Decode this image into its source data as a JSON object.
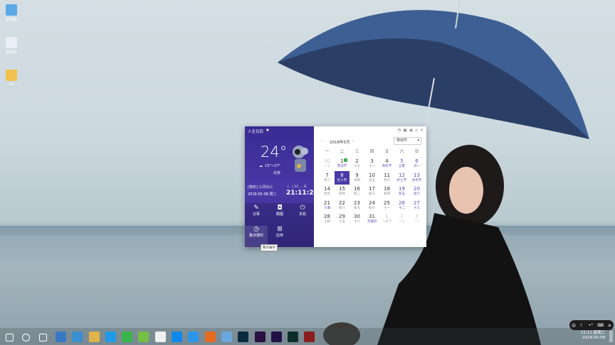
{
  "desktop": {
    "icons": [
      {
        "label": "此电脑",
        "icon": "computer-icon",
        "color": "#5aa9e6"
      },
      {
        "label": "回收站",
        "icon": "recycle-bin-icon",
        "color": "#e8eef3"
      },
      {
        "label": "ssd",
        "icon": "folder-icon",
        "color": "#f1c24b"
      }
    ]
  },
  "widget": {
    "title": "人生日历",
    "temperature": "24°",
    "temp_range": "13°~27°",
    "city": "北京",
    "lunar_info": "[狗年] 三月廿三",
    "time_hint": "[...] 22:... 天",
    "date_text": "2018-05-08 周二",
    "clock": "21:11:25",
    "tiles": [
      {
        "label": "记事",
        "icon": "note-icon"
      },
      {
        "label": "截图",
        "icon": "camera-icon"
      },
      {
        "label": "关机",
        "icon": "power-icon"
      },
      {
        "label": "整点报时",
        "icon": "clock-icon"
      },
      {
        "label": "应用",
        "icon": "grid-icon"
      }
    ],
    "tooltip": "整点报时",
    "calendar": {
      "month_label": "2018年5月",
      "holiday_select": "劳动节",
      "weekdays": [
        "一",
        "二",
        "三",
        "四",
        "五",
        "六",
        "日"
      ],
      "rows": [
        [
          {
            "d": "30",
            "l": "十五",
            "faded": true
          },
          {
            "d": "1",
            "l": "劳动节",
            "hl": true
          },
          {
            "d": "2",
            "l": "十七"
          },
          {
            "d": "3",
            "l": "十八"
          },
          {
            "d": "4",
            "l": "青年节",
            "hl": true
          },
          {
            "d": "5",
            "l": "立夏",
            "we": true
          },
          {
            "d": "6",
            "l": "廿一",
            "we": true
          }
        ],
        [
          {
            "d": "7",
            "l": "廿二"
          },
          {
            "d": "8",
            "l": "红十字",
            "today": true
          },
          {
            "d": "9",
            "l": "廿四"
          },
          {
            "d": "10",
            "l": "廿五"
          },
          {
            "d": "11",
            "l": "廿六"
          },
          {
            "d": "12",
            "l": "护士节",
            "we": true
          },
          {
            "d": "13",
            "l": "母亲节",
            "we": true
          }
        ],
        [
          {
            "d": "14",
            "l": "廿九"
          },
          {
            "d": "15",
            "l": "四月"
          },
          {
            "d": "16",
            "l": "初二"
          },
          {
            "d": "17",
            "l": "初三"
          },
          {
            "d": "18",
            "l": "初四"
          },
          {
            "d": "19",
            "l": "初五",
            "we": true
          },
          {
            "d": "20",
            "l": "初六",
            "we": true
          }
        ],
        [
          {
            "d": "21",
            "l": "小满",
            "hl": true
          },
          {
            "d": "22",
            "l": "初八"
          },
          {
            "d": "23",
            "l": "初九"
          },
          {
            "d": "24",
            "l": "初十"
          },
          {
            "d": "25",
            "l": "十一"
          },
          {
            "d": "26",
            "l": "十二",
            "we": true
          },
          {
            "d": "27",
            "l": "十三",
            "we": true
          }
        ],
        [
          {
            "d": "28",
            "l": "十四"
          },
          {
            "d": "29",
            "l": "十五"
          },
          {
            "d": "30",
            "l": "十六"
          },
          {
            "d": "31",
            "l": "无烟日",
            "hl": true
          },
          {
            "d": "1",
            "l": "儿童节",
            "faded": true
          },
          {
            "d": "2",
            "l": "十九",
            "faded": true
          },
          {
            "d": "3",
            "l": "二十",
            "faded": true
          }
        ]
      ]
    }
  },
  "taskbar": {
    "icons": [
      {
        "name": "start-icon",
        "color": "#ffffff"
      },
      {
        "name": "cortana-icon",
        "color": "#ffffff"
      },
      {
        "name": "task-view-icon",
        "color": "#ffffff"
      },
      {
        "name": "browser-icon",
        "color": "#3a78c4"
      },
      {
        "name": "mail-icon",
        "color": "#3a8fd0"
      },
      {
        "name": "file-explorer-icon",
        "color": "#e0b34a"
      },
      {
        "name": "star-app-icon",
        "color": "#1e9be8"
      },
      {
        "name": "wechat-icon",
        "color": "#38b549"
      },
      {
        "name": "leaf-app-icon",
        "color": "#75c043"
      },
      {
        "name": "word-app-icon",
        "color": "#f0f0f0"
      },
      {
        "name": "zhihu-icon",
        "color": "#0f88eb"
      },
      {
        "name": "qq-browser-icon",
        "color": "#2b96e8"
      },
      {
        "name": "firefox-icon",
        "color": "#e66a1f"
      },
      {
        "name": "notes-icon",
        "color": "#6aa7dc"
      },
      {
        "name": "photoshop-icon",
        "color": "#0b2a3e"
      },
      {
        "name": "premiere-icon",
        "color": "#2a1043"
      },
      {
        "name": "after-effects-icon",
        "color": "#1f1245"
      },
      {
        "name": "audition-icon",
        "color": "#0d2e2a"
      },
      {
        "name": "red-app-icon",
        "color": "#8a1c1c"
      }
    ],
    "tray_label": "中",
    "clock_time": "21:11 星期二",
    "clock_date": "2018-05-08"
  }
}
